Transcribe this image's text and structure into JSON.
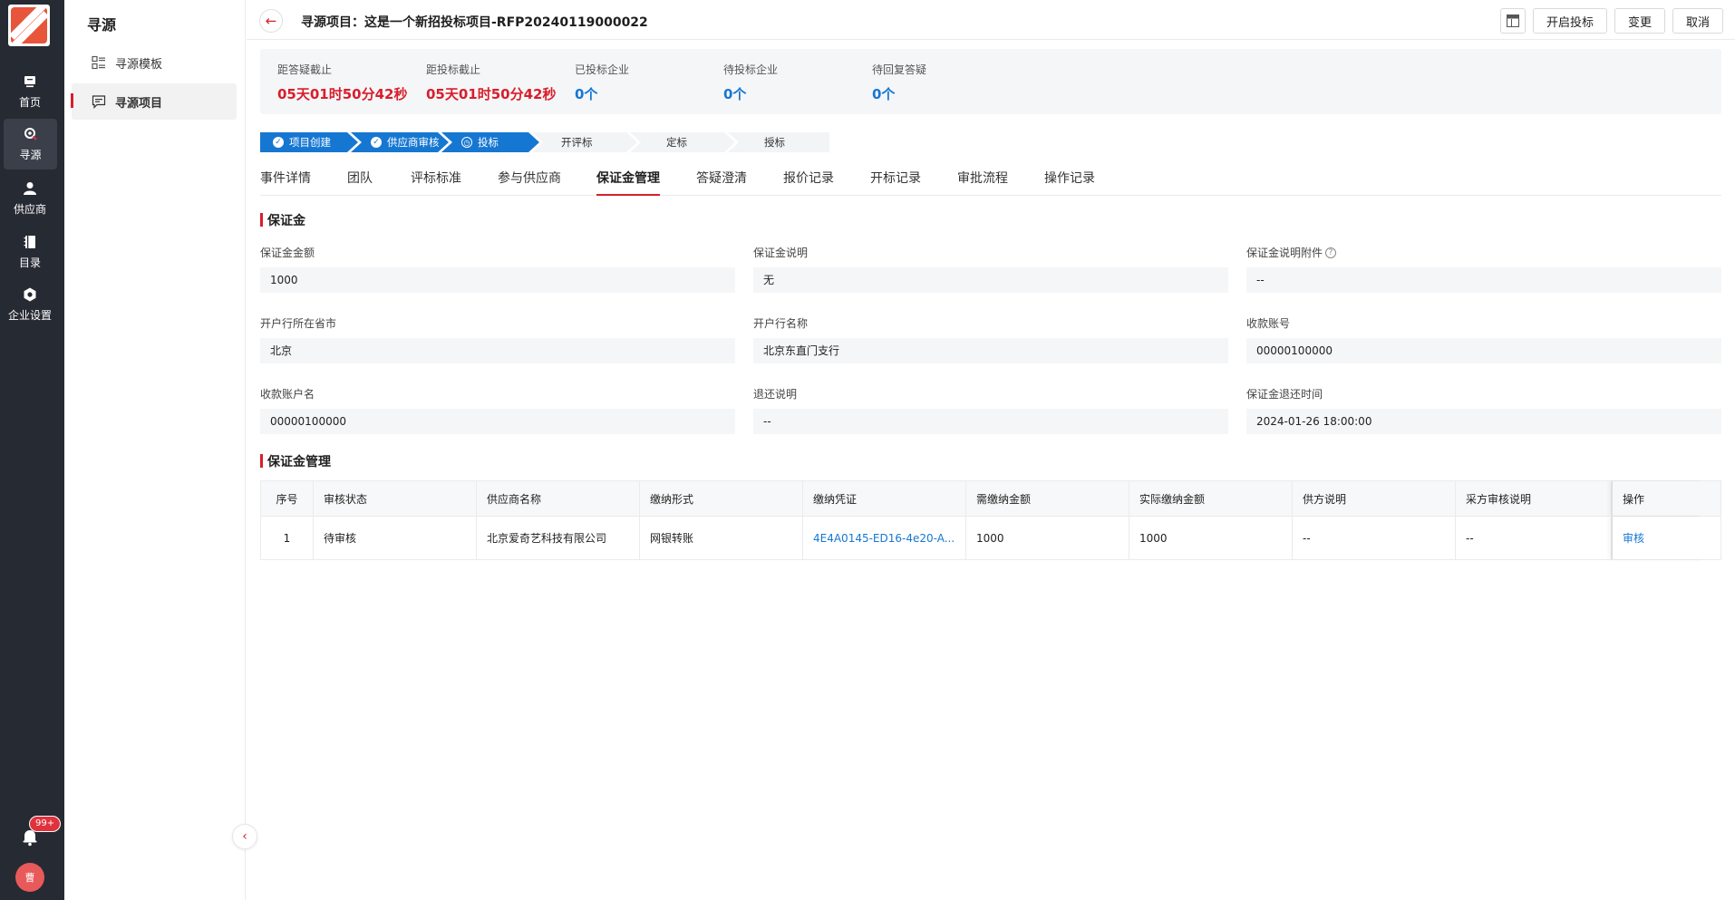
{
  "rail": {
    "items": [
      {
        "label": "首页",
        "icon": "home-icon"
      },
      {
        "label": "寻源",
        "icon": "search-icon"
      },
      {
        "label": "供应商",
        "icon": "supplier-icon"
      },
      {
        "label": "目录",
        "icon": "catalog-icon"
      },
      {
        "label": "企业设置",
        "icon": "settings-icon"
      }
    ],
    "notification_badge": "99+",
    "avatar_text": "曹"
  },
  "sidebar": {
    "title": "寻源",
    "items": [
      {
        "label": "寻源模板",
        "icon": "template-list-icon"
      },
      {
        "label": "寻源项目",
        "icon": "project-icon"
      }
    ]
  },
  "header": {
    "title": "寻源项目：这是一个新招投标项目-RFP20240119000022",
    "buttons": {
      "start": "开启投标",
      "change": "变更",
      "cancel": "取消"
    }
  },
  "stats": [
    {
      "label": "距答疑截止",
      "value": "05天01时50分42秒",
      "color": "#d81e2c"
    },
    {
      "label": "距投标截止",
      "value": "05天01时50分42秒",
      "color": "#d81e2c"
    },
    {
      "label": "已投标企业",
      "value": "0个",
      "color": "#1677d2"
    },
    {
      "label": "待投标企业",
      "value": "0个",
      "color": "#1677d2"
    },
    {
      "label": "待回复答疑",
      "value": "0个",
      "color": "#1677d2"
    }
  ],
  "steps": [
    {
      "label": "项目创建",
      "state": "done",
      "icon": "check-icon"
    },
    {
      "label": "供应商审核",
      "state": "done",
      "icon": "check-icon"
    },
    {
      "label": "投标",
      "state": "current",
      "icon": "clock-icon"
    },
    {
      "label": "开评标",
      "state": "todo"
    },
    {
      "label": "定标",
      "state": "todo"
    },
    {
      "label": "授标",
      "state": "todo"
    }
  ],
  "tabs": [
    "事件详情",
    "团队",
    "评标标准",
    "参与供应商",
    "保证金管理",
    "答疑澄清",
    "报价记录",
    "开标记录",
    "审批流程",
    "操作记录"
  ],
  "active_tab": "保证金管理",
  "deposit": {
    "section_title": "保证金",
    "fields": [
      {
        "label": "保证金金额",
        "value": "1000"
      },
      {
        "label": "保证金说明",
        "value": "无"
      },
      {
        "label": "保证金说明附件",
        "value": "--"
      },
      {
        "label": "开户行所在省市",
        "value": "北京"
      },
      {
        "label": "开户行名称",
        "value": "北京东直门支行"
      },
      {
        "label": "收款账号",
        "value": "00000100000"
      },
      {
        "label": "收款账户名",
        "value": "00000100000"
      },
      {
        "label": "退还说明",
        "value": "--"
      },
      {
        "label": "保证金退还时间",
        "value": "2024-01-26 18:00:00"
      }
    ]
  },
  "management": {
    "section_title": "保证金管理",
    "columns": [
      "序号",
      "审核状态",
      "供应商名称",
      "缴纳形式",
      "缴纳凭证",
      "需缴纳金额",
      "实际缴纳金额",
      "供方说明",
      "采方审核说明",
      "操作"
    ],
    "rows": [
      [
        "1",
        "待审核",
        "北京爱奇艺科技有限公司",
        "网银转账",
        "4E4A0145-ED16-4e20-A...",
        "1000",
        "1000",
        "--",
        "--",
        "审核"
      ]
    ]
  }
}
